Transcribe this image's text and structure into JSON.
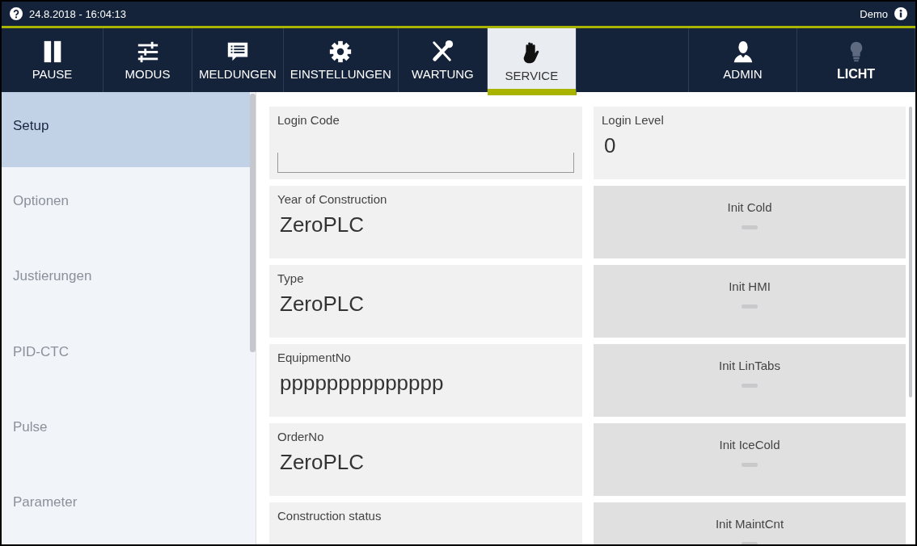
{
  "status_bar": {
    "datetime": "24.8.2018 - 16:04:13",
    "user": "Demo"
  },
  "nav": [
    {
      "label": "PAUSE",
      "kind": "pause",
      "selected": false
    },
    {
      "label": "MODUS",
      "kind": "sliders",
      "selected": false
    },
    {
      "label": "MELDUNGEN",
      "kind": "message",
      "selected": false
    },
    {
      "label": "EINSTELLUNGEN",
      "kind": "gear",
      "selected": false
    },
    {
      "label": "WARTUNG",
      "kind": "tools",
      "selected": false
    },
    {
      "label": "SERVICE",
      "kind": "hand",
      "selected": true
    },
    {
      "label": "ADMIN",
      "kind": "user",
      "selected": false
    },
    {
      "label": "LICHT",
      "kind": "bulb",
      "selected": false
    }
  ],
  "sidebar": {
    "items": [
      {
        "label": "Setup",
        "selected": true,
        "disabled": false
      },
      {
        "label": "Optionen",
        "selected": false,
        "disabled": true
      },
      {
        "label": "Justierungen",
        "selected": false,
        "disabled": true
      },
      {
        "label": "PID-CTC",
        "selected": false,
        "disabled": true
      },
      {
        "label": "Pulse",
        "selected": false,
        "disabled": true
      },
      {
        "label": "Parameter",
        "selected": false,
        "disabled": true
      }
    ]
  },
  "fields": [
    {
      "label": "Login Code",
      "kind": "input"
    },
    {
      "label": "Login Level",
      "kind": "display",
      "value": "0"
    },
    {
      "label": "Year of Construction",
      "kind": "display",
      "value": "ZeroPLC"
    },
    {
      "label": "Init Cold",
      "kind": "button",
      "on": false
    },
    {
      "label": "Type",
      "kind": "display",
      "value": "ZeroPLC"
    },
    {
      "label": "Init HMI",
      "kind": "button",
      "on": false
    },
    {
      "label": "EquipmentNo",
      "kind": "display",
      "value": "pppppppppppppp"
    },
    {
      "label": "Init LinTabs",
      "kind": "button",
      "on": false
    },
    {
      "label": "OrderNo",
      "kind": "display",
      "value": "ZeroPLC"
    },
    {
      "label": "Init IceCold",
      "kind": "button",
      "on": false
    },
    {
      "label": "Construction status",
      "kind": "display"
    },
    {
      "label": "Init MaintCnt",
      "kind": "button",
      "on": false
    }
  ]
}
